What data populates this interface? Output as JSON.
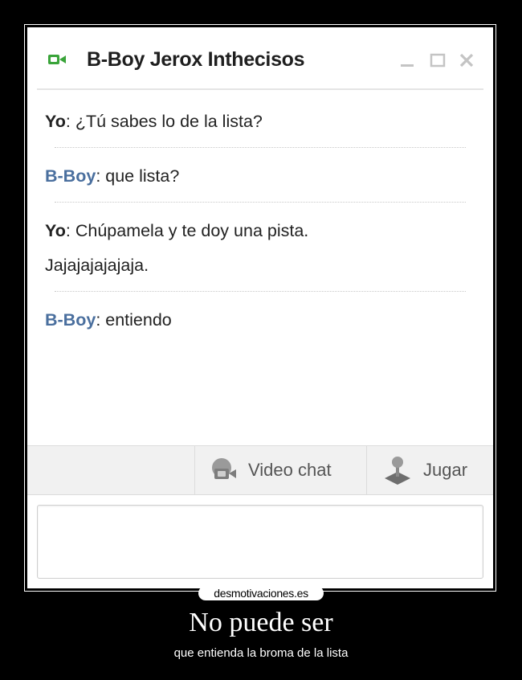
{
  "chat": {
    "title": "B-Boy Jerox Inthecisos",
    "messages": [
      {
        "speaker": "Yo",
        "text": ": ¿Tú sabes lo de la lista?"
      },
      {
        "speaker": "B-Boy",
        "text": ": que lista?"
      },
      {
        "speaker": "Yo",
        "text": ": Chúpamela y te doy una pista.",
        "continuation": "Jajajajajajaja."
      },
      {
        "speaker": "B-Boy",
        "text": ": entiendo"
      }
    ],
    "toolbar": {
      "video_label": "Video chat",
      "game_label": "Jugar"
    },
    "input_value": ""
  },
  "poster": {
    "watermark": "desmotivaciones.es",
    "title": "No puede ser",
    "subtitle": "que entienda la broma de la lista"
  },
  "colors": {
    "background": "#000000",
    "speaker_other": "#4a6f9e",
    "video_icon": "#3aa43a"
  },
  "icons": [
    "video-camera-icon",
    "minimize-icon",
    "maximize-icon",
    "close-icon",
    "video-chat-icon",
    "joystick-icon"
  ]
}
